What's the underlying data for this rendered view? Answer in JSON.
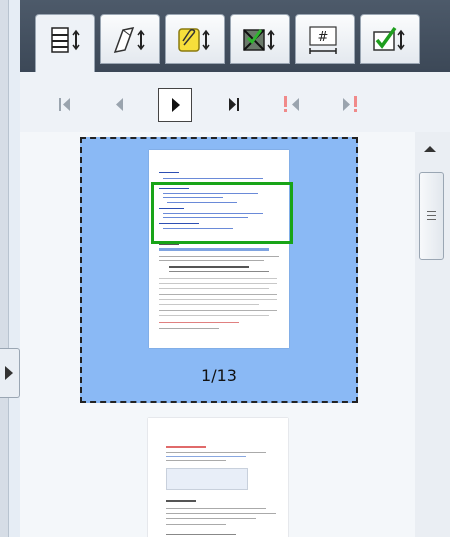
{
  "toolbar": {
    "tabs": [
      {
        "name": "page-thumbnails",
        "icon": "page-stack-icon",
        "active": true
      },
      {
        "name": "annotations",
        "icon": "pen-icon",
        "active": false
      },
      {
        "name": "notes",
        "icon": "paperclip-note-icon",
        "active": false
      },
      {
        "name": "redactions",
        "icon": "redaction-icon",
        "active": false
      },
      {
        "name": "bates-numbering",
        "icon": "bates-number-icon",
        "active": false
      },
      {
        "name": "checkmarks",
        "icon": "checkmark-icon",
        "active": false
      }
    ]
  },
  "navigation": {
    "buttons": [
      {
        "name": "first-page",
        "icon": "first-page-icon",
        "enabled": false
      },
      {
        "name": "previous-page",
        "icon": "previous-page-icon",
        "enabled": false
      },
      {
        "name": "next-page",
        "icon": "next-page-icon",
        "enabled": true
      },
      {
        "name": "last-page",
        "icon": "last-page-icon",
        "enabled": true
      },
      {
        "name": "previous-flagged",
        "icon": "previous-flagged-icon",
        "enabled": false
      },
      {
        "name": "next-flagged",
        "icon": "next-flagged-icon",
        "enabled": false
      }
    ]
  },
  "thumbnails": {
    "current_label": "1/13",
    "pages": [
      {
        "index": 1,
        "selected": true
      },
      {
        "index": 2,
        "selected": false
      }
    ]
  },
  "colors": {
    "selection": "#8ab9f5",
    "highlight": "#18a418",
    "tabbar": "#3c4857"
  }
}
